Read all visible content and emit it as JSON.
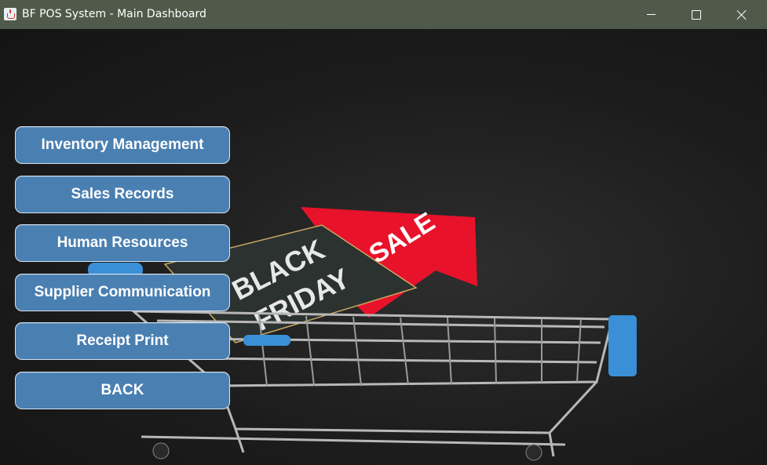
{
  "window": {
    "title": "BF POS System - Main Dashboard",
    "controls": {
      "minimize": "minimize",
      "maximize": "maximize",
      "close": "close"
    }
  },
  "background": {
    "image": "black-friday-shopping-cart",
    "tag_text_line1": "BLACK",
    "tag_text_line2": "FRIDAY",
    "arrow_text": "SALE",
    "colors": {
      "tag": "#2b3230",
      "arrow": "#e8122b",
      "cart_wire": "#b8b8b8",
      "cart_handle": "#3a8fd6"
    }
  },
  "menu": {
    "items": [
      {
        "label": "Inventory Management"
      },
      {
        "label": "Sales Records"
      },
      {
        "label": "Human Resources"
      },
      {
        "label": "Supplier Communication"
      },
      {
        "label": "Receipt Print"
      },
      {
        "label": "BACK"
      }
    ],
    "colors": {
      "button": "#4a7fb1",
      "border": "#d6e4f2",
      "text": "#ffffff"
    }
  }
}
